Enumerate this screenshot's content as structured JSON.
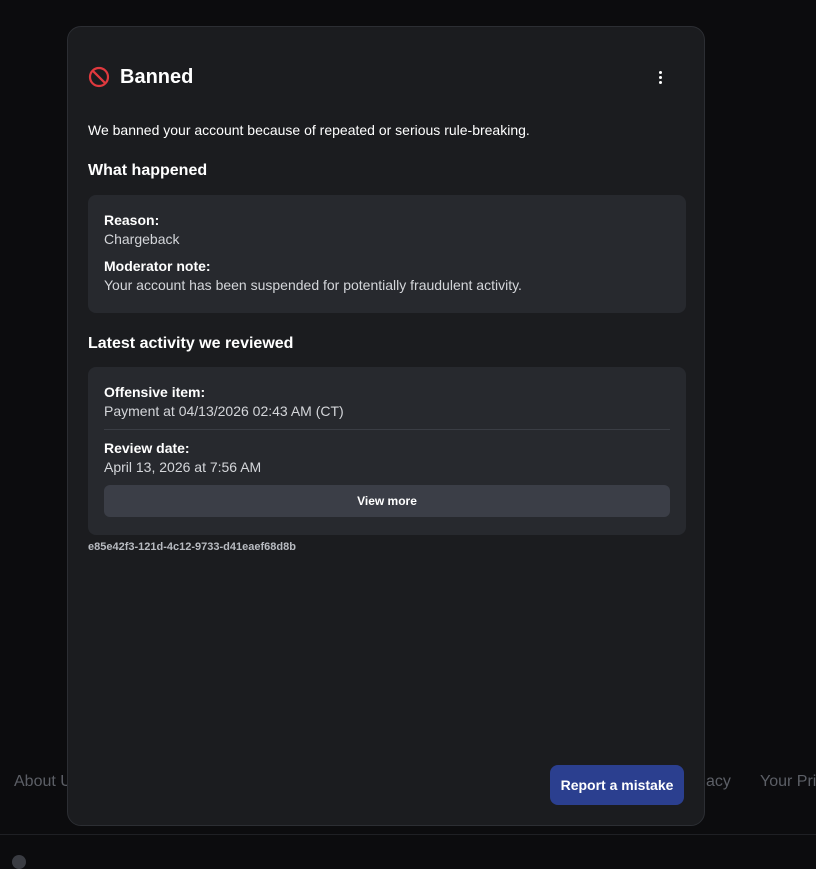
{
  "background": {
    "footer_links": [
      "About U",
      "acy",
      "Your Pri"
    ]
  },
  "modal": {
    "title": "Banned",
    "ban_icon": "no-entry-icon",
    "more_icon": "more-vertical-icon",
    "intro": "We banned your account because of repeated or serious rule-breaking.",
    "what_happened": {
      "heading": "What happened",
      "reason_label": "Reason:",
      "reason_value": "Chargeback",
      "note_label": "Moderator note:",
      "note_value": "Your account has been suspended for potentially fraudulent activity."
    },
    "latest_activity": {
      "heading": "Latest activity we reviewed",
      "item_label": "Offensive item:",
      "item_value": "Payment at 04/13/2026 02:43 AM (CT)",
      "review_label": "Review date:",
      "review_value": "April 13, 2026 at 7:56 AM",
      "view_more_label": "View more"
    },
    "reference_id": "e85e42f3-121d-4c12-9733-d41eaef68d8b",
    "report_label": "Report a mistake"
  },
  "colors": {
    "accent_button": "#2b3f8f",
    "ban_red": "#e0393e",
    "modal_bg": "#1b1c1f",
    "panel_bg": "#27292e"
  }
}
